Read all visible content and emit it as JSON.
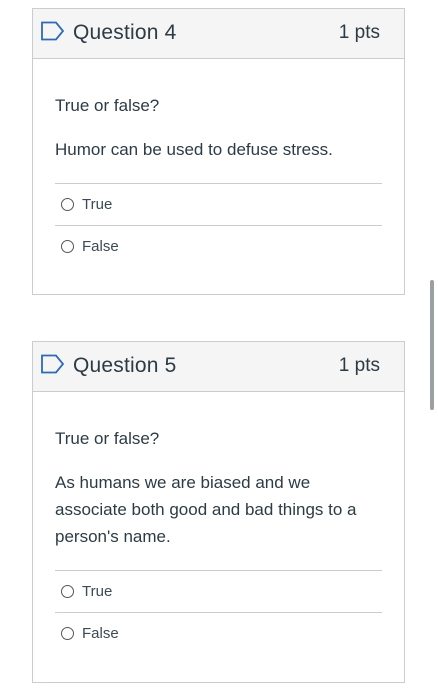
{
  "questions": [
    {
      "title": "Question 4",
      "points": "1 pts",
      "type_label": "True or false?",
      "text": "Humor can be used to defuse stress.",
      "answers": [
        "True",
        "False"
      ]
    },
    {
      "title": "Question 5",
      "points": "1 pts",
      "type_label": "True or false?",
      "text": "As humans we are biased and we associate both good and bad things to a person's name.",
      "answers": [
        "True",
        "False"
      ]
    }
  ],
  "icons": {
    "question_flag": "flag-outline-icon"
  },
  "colors": {
    "flag_stroke": "#2d6ab4",
    "header_bg": "#f5f5f5",
    "border": "#c7cdd1",
    "text": "#2d3b45"
  }
}
